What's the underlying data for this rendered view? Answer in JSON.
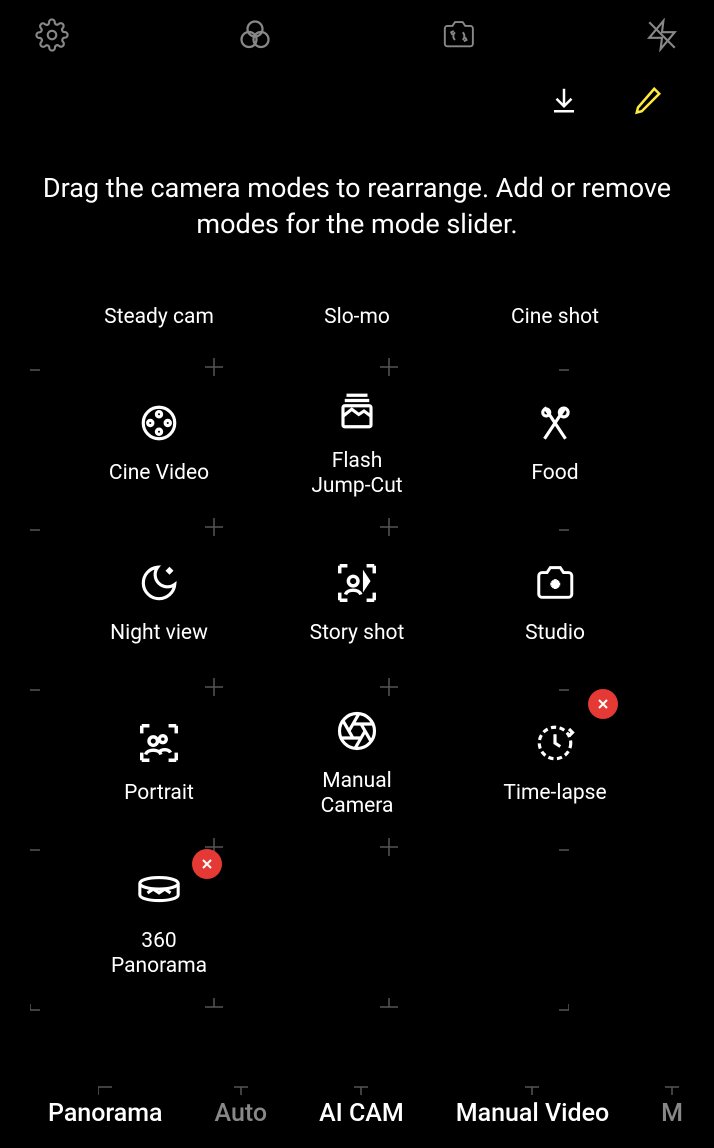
{
  "instructions": "Drag the camera modes to rearrange. Add or remove modes for the mode slider.",
  "modes": {
    "row0": [
      {
        "label": "Steady cam"
      },
      {
        "label": "Slo-mo"
      },
      {
        "label": "Cine shot"
      }
    ],
    "row1": [
      {
        "label": "Cine Video",
        "icon": "reel"
      },
      {
        "label": "Flash\nJump-Cut",
        "icon": "stack"
      },
      {
        "label": "Food",
        "icon": "utensils"
      }
    ],
    "row2": [
      {
        "label": "Night view",
        "icon": "moon"
      },
      {
        "label": "Story shot",
        "icon": "person-frame"
      },
      {
        "label": "Studio",
        "icon": "camera-sparkle"
      }
    ],
    "row3": [
      {
        "label": "Portrait",
        "icon": "portrait"
      },
      {
        "label": "Manual\nCamera",
        "icon": "aperture"
      },
      {
        "label": "Time-lapse",
        "icon": "clock",
        "removable": true
      }
    ],
    "row4": [
      {
        "label": "360\nPanorama",
        "icon": "pano360",
        "removable": true
      }
    ]
  },
  "tabs": [
    {
      "label": "Panorama",
      "dim": false
    },
    {
      "label": "Auto",
      "dim": true
    },
    {
      "label": "AI CAM",
      "dim": false
    },
    {
      "label": "Manual Video",
      "dim": false
    },
    {
      "label": "M",
      "dim": true
    }
  ]
}
